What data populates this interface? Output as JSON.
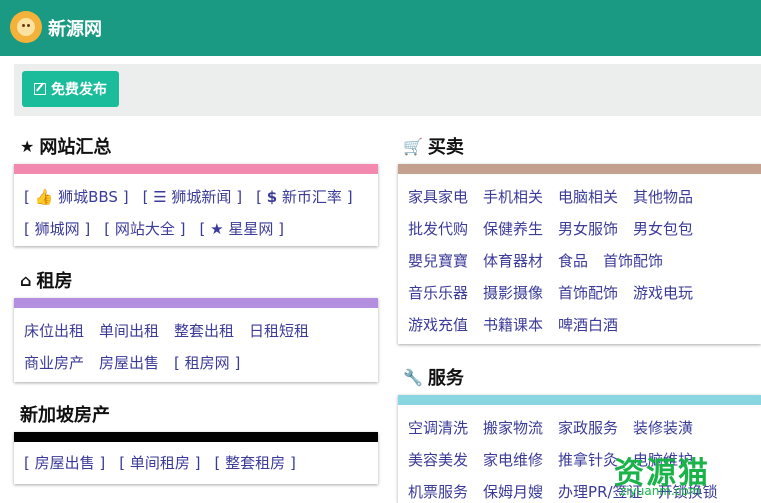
{
  "header": {
    "site_title": "新源网",
    "logo_icon": "lion-logo-icon",
    "bg_color": "#1a9a82"
  },
  "toolbar": {
    "publish_label": "免费发布",
    "publish_icon": "edit-icon",
    "button_color": "#1abc9c"
  },
  "sections": {
    "websites": {
      "title": "网站汇总",
      "icon": "star-icon",
      "bar_color": "#f28ab0",
      "rows": [
        [
          {
            "icon": "thumbs-up-icon",
            "glyph": "👍",
            "label": "狮城BBS"
          },
          {
            "icon": "rss-icon",
            "glyph": "☰",
            "label": "狮城新闻"
          },
          {
            "icon": "dollar-icon",
            "glyph": "$",
            "label": "新币汇率"
          }
        ],
        [
          {
            "icon": "",
            "glyph": "",
            "label": "狮城网"
          },
          {
            "icon": "",
            "glyph": "",
            "label": "网站大全"
          },
          {
            "icon": "star-icon",
            "glyph": "★",
            "label": "星星网"
          }
        ]
      ]
    },
    "rental": {
      "title": "租房",
      "icon": "home-icon",
      "bar_color": "#b48fe0",
      "row1": [
        "床位出租",
        "单间出租",
        "整套出租",
        "日租短租"
      ],
      "row2": [
        "商业房产",
        "房屋出售"
      ],
      "bracket": "租房网"
    },
    "property": {
      "title": "新加坡房产",
      "bar_color": "#000000",
      "items": [
        "房屋出售",
        "单间租房",
        "整套租房"
      ]
    },
    "trade": {
      "title": "买卖",
      "icon": "cart-icon",
      "bar_color": "#c4a08e",
      "rows": [
        [
          "家具家电",
          "手机相关",
          "电脑相关",
          "其他物品"
        ],
        [
          "批发代购",
          "保健养生",
          "男女服饰",
          "男女包包"
        ],
        [
          "嬰兒寶寶",
          "体育器材",
          "食品",
          "首饰配饰"
        ],
        [
          "音乐乐器",
          "摄影摄像",
          "首饰配饰",
          "游戏电玩"
        ],
        [
          "游戏充值",
          "书籍课本",
          "啤酒白酒"
        ]
      ]
    },
    "services": {
      "title": "服务",
      "icon": "wrench-icon",
      "bar_color": "#8ad6e0",
      "rows": [
        [
          "空调清洗",
          "搬家物流",
          "家政服务",
          "装修装潢"
        ],
        [
          "美容美发",
          "家电维修",
          "推拿针灸",
          "电脑维护"
        ],
        [
          "机票服务",
          "保姆月嫂",
          "办理PR/签证",
          "开锁换锁"
        ]
      ]
    }
  },
  "watermark": {
    "text": "资源猫",
    "url_text": "ziyuanm.com",
    "color": "#1ab34a"
  }
}
